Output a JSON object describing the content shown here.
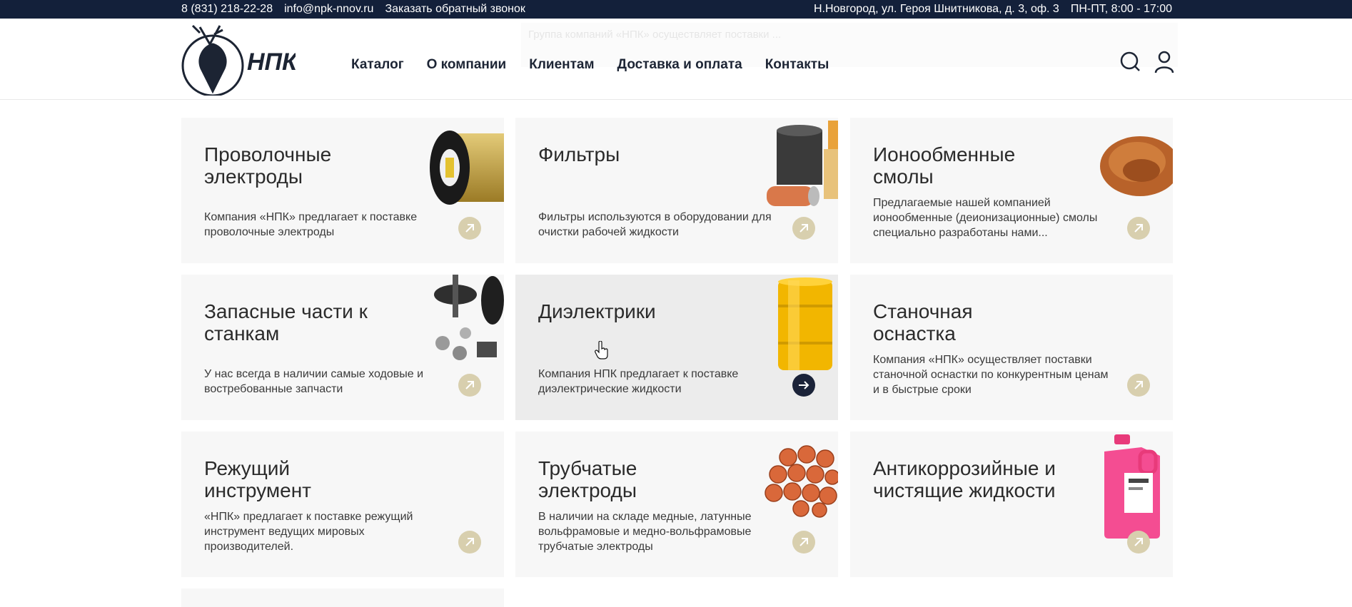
{
  "topbar": {
    "phone": "8 (831) 218-22-28",
    "email": "info@npk-nnov.ru",
    "callback": "Заказать обратный звонок",
    "address": "Н.Новгород, ул. Героя Шнитникова, д. 3, оф. 3",
    "hours": "ПН-ПТ, 8:00 - 17:00"
  },
  "header": {
    "logo_text": "НПК",
    "nav": [
      "Каталог",
      "О компании",
      "Клиентам",
      "Доставка и оплата",
      "Контакты"
    ],
    "ghost_banner": "Группа компаний «НПК» осуществляет поставки ...",
    "icons": [
      "search-icon",
      "user-icon"
    ]
  },
  "cards": [
    {
      "title": "Проволочные электроды",
      "desc": "Компания «НПК» предлагает к поставке проволочные электроды",
      "image": "wire-spool-image"
    },
    {
      "title": "Фильтры",
      "desc": "Фильтры используются в оборудовании для очистки рабочей жидкости",
      "image": "filters-image"
    },
    {
      "title": "Ионообменные смолы",
      "desc": "Предлагаемые нашей компанией ионообменные (деионизационные) смолы специально разработаны нами...",
      "image": "resin-image"
    },
    {
      "title": "Запасные части к станкам",
      "desc": "У нас всегда в наличии самые ходовые и востребованные запчасти",
      "image": "spare-parts-image"
    },
    {
      "title": "Диэлектрики",
      "desc": "Компания НПК предлагает к поставке диэлектрические жидкости",
      "image": "barrel-image"
    },
    {
      "title": "Станочная оснастка",
      "desc": "Компания «НПК» осуществляет поставки станочной оснастки по конкурентным ценам и в быстрые сроки",
      "image": ""
    },
    {
      "title": "Режущий инструмент",
      "desc": "«НПК» предлагает к поставке режущий инструмент ведущих мировых производителей.",
      "image": ""
    },
    {
      "title": "Трубчатые электроды",
      "desc": "В наличии на складе медные, латунные вольфрамовые и медно-вольфрамовые трубчатые электроды",
      "image": "tube-electrodes-image"
    },
    {
      "title": "Антикоррозийные и чистящие жидкости",
      "desc": "",
      "image": "canister-image"
    }
  ],
  "colors": {
    "topbar_bg": "#13203a",
    "card_bg": "#f7f7f7",
    "card_active_bg": "#ececec",
    "arrow_inactive": "#d8cfae",
    "arrow_active": "#1b2339"
  }
}
